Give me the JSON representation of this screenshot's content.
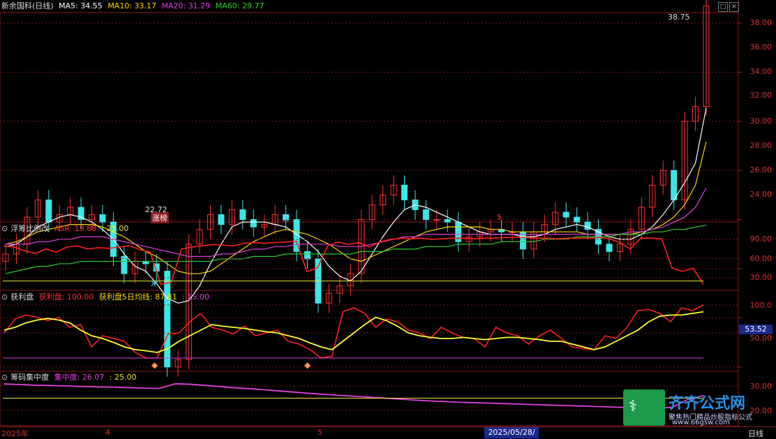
{
  "stock": {
    "title": "新余国科(日线)",
    "ma5": "MA5: 34.55",
    "ma10": "MA10: 33.17",
    "ma20": "MA20: 31.29",
    "ma60": "MA60: 29.77",
    "high_label": "38.75",
    "low_label": "22.72",
    "marks": [
      "涨榜",
      "财",
      "$"
    ]
  },
  "price_axis": [
    "38.00",
    "36.00",
    "34.00",
    "32.00",
    "30.00",
    "28.00",
    "26.00",
    "24.00"
  ],
  "panel_asr": {
    "title": "浮筹比例改",
    "label": "ASR: 19.88",
    "level": ": 25.00",
    "axis": [
      "90.00",
      "60.00",
      "30.00"
    ]
  },
  "panel_profit": {
    "title": "获利盘",
    "label": "获利盘: 100.00",
    "ma_label": "获利盘5日均线: 87.81",
    "level": ": 15.00",
    "axis": [
      "100.0",
      "50.00"
    ],
    "cursor_value": "53.52"
  },
  "panel_conc": {
    "title": "筹码集中度",
    "label": "集中度: 26.07",
    "level": ": 25.00",
    "axis": [
      "30.00",
      "20.00"
    ]
  },
  "date_axis": {
    "labels": [
      "2025年",
      "4",
      "5"
    ],
    "cursor_date": "2025/05/28/三",
    "period": "日线"
  },
  "watermark": {
    "brand": "齐齐公式网",
    "slogan": "聚焦热门精品炒股指标公式",
    "url": "www.66gsw.com"
  },
  "colors": {
    "up": "#ff3030",
    "down": "#3ce6e6",
    "ma5": "#ffffff",
    "ma10": "#ffd700",
    "ma20": "#e040e0",
    "ma60": "#30d030",
    "asr": "#ff2020",
    "level_line": "#e8e840",
    "conc": "#e040e0"
  },
  "icons": [
    "maximize-icon",
    "close-icon",
    "butterfly-icon",
    "diamond-icon",
    "dollar-icon"
  ],
  "chart_data": [
    {
      "type": "line",
      "title": "新余国科(日线)",
      "note": "candlestick price chart",
      "ylim": [
        23,
        39
      ],
      "x_count": 66,
      "series": [
        {
          "name": "close",
          "values": [
            28.6,
            29.0,
            30.1,
            30.8,
            29.9,
            30.2,
            30.5,
            30.0,
            30.2,
            29.9,
            28.5,
            27.8,
            28.3,
            28.2,
            27.9,
            24.0,
            24.3,
            29.0,
            29.6,
            30.2,
            29.8,
            30.4,
            30.0,
            29.7,
            29.8,
            30.2,
            30.0,
            28.7,
            28.4,
            26.6,
            27.0,
            27.3,
            27.8,
            30.0,
            30.6,
            31.0,
            31.4,
            30.8,
            30.4,
            30.0,
            30.0,
            29.9,
            29.1,
            29.3,
            29.5,
            29.6,
            29.5,
            29.5,
            28.8,
            29.5,
            29.8,
            30.3,
            30.1,
            29.9,
            29.6,
            29.0,
            28.7,
            29.0,
            29.6,
            30.5,
            31.4,
            32.0,
            30.8,
            34.0,
            34.6,
            38.7
          ]
        },
        {
          "name": "MA5",
          "values": [
            28.9,
            29.0,
            29.3,
            29.7,
            29.9,
            30.1,
            30.2,
            30.1,
            29.9,
            29.6,
            29.2,
            28.6,
            28.1,
            27.9,
            27.4,
            26.8,
            26.6,
            26.7,
            27.3,
            28.2,
            29.0,
            29.7,
            29.9,
            29.9,
            29.9,
            29.8,
            29.7,
            29.4,
            29.1,
            28.7,
            28.1,
            27.7,
            27.5,
            27.9,
            28.6,
            29.3,
            29.9,
            30.4,
            30.6,
            30.5,
            30.3,
            30.1,
            29.9,
            29.7,
            29.5,
            29.4,
            29.4,
            29.4,
            29.3,
            29.3,
            29.4,
            29.6,
            29.7,
            29.8,
            29.7,
            29.5,
            29.3,
            29.2,
            29.2,
            29.4,
            29.7,
            30.2,
            30.8,
            31.5,
            32.3,
            34.55
          ]
        },
        {
          "name": "MA10",
          "values": [
            29.0,
            29.1,
            29.3,
            29.5,
            29.6,
            29.7,
            29.8,
            29.8,
            29.8,
            29.7,
            29.5,
            29.3,
            29.0,
            28.7,
            28.5,
            28.2,
            27.9,
            27.8,
            27.8,
            27.9,
            28.2,
            28.5,
            28.8,
            29.1,
            29.3,
            29.5,
            29.6,
            29.5,
            29.4,
            29.2,
            29.0,
            28.7,
            28.4,
            28.3,
            28.5,
            28.7,
            28.9,
            29.1,
            29.3,
            29.5,
            29.6,
            29.7,
            29.7,
            29.7,
            29.7,
            29.6,
            29.6,
            29.5,
            29.5,
            29.5,
            29.5,
            29.5,
            29.5,
            29.5,
            29.4,
            29.4,
            29.4,
            29.4,
            29.4,
            29.5,
            29.6,
            29.8,
            30.1,
            30.6,
            31.4,
            33.17
          ]
        },
        {
          "name": "MA20",
          "values": [
            29.0,
            29.0,
            29.0,
            29.1,
            29.1,
            29.2,
            29.2,
            29.3,
            29.3,
            29.3,
            29.2,
            29.1,
            29.0,
            28.9,
            28.8,
            28.7,
            28.6,
            28.5,
            28.5,
            28.5,
            28.6,
            28.6,
            28.7,
            28.8,
            28.8,
            28.9,
            28.9,
            29.0,
            29.0,
            29.0,
            29.0,
            28.9,
            28.9,
            28.9,
            29.0,
            29.1,
            29.2,
            29.3,
            29.3,
            29.4,
            29.4,
            29.4,
            29.4,
            29.4,
            29.4,
            29.4,
            29.4,
            29.4,
            29.4,
            29.4,
            29.4,
            29.4,
            29.4,
            29.4,
            29.4,
            29.4,
            29.4,
            29.4,
            29.5,
            29.5,
            29.6,
            29.7,
            29.9,
            30.1,
            30.5,
            31.29
          ]
        },
        {
          "name": "MA60",
          "values": [
            27.8,
            27.9,
            28.0,
            28.1,
            28.1,
            28.2,
            28.2,
            28.3,
            28.3,
            28.3,
            28.3,
            28.3,
            28.3,
            28.3,
            28.3,
            28.3,
            28.3,
            28.3,
            28.3,
            28.3,
            28.4,
            28.4,
            28.4,
            28.5,
            28.5,
            28.5,
            28.6,
            28.6,
            28.6,
            28.6,
            28.6,
            28.6,
            28.6,
            28.7,
            28.7,
            28.7,
            28.8,
            28.8,
            28.8,
            28.9,
            28.9,
            28.9,
            29.0,
            29.0,
            29.0,
            29.0,
            29.1,
            29.1,
            29.1,
            29.1,
            29.2,
            29.2,
            29.2,
            29.3,
            29.3,
            29.3,
            29.3,
            29.4,
            29.4,
            29.4,
            29.5,
            29.5,
            29.6,
            29.6,
            29.7,
            29.77
          ]
        }
      ]
    },
    {
      "type": "line",
      "title": "浮筹比例改",
      "ylim": [
        15,
        100
      ],
      "series": [
        {
          "name": "ASR",
          "values": [
            80,
            78,
            72,
            68,
            75,
            70,
            78,
            80,
            75,
            77,
            76,
            78,
            80,
            74,
            70,
            20,
            23,
            75,
            78,
            80,
            82,
            81,
            80,
            84,
            85,
            84,
            85,
            86,
            87,
            40,
            45,
            80,
            86,
            82,
            85,
            78,
            86,
            90,
            92,
            91,
            92,
            90,
            91,
            92,
            92,
            91,
            92,
            92,
            93,
            93,
            93,
            92,
            92,
            91,
            92,
            92,
            92,
            93,
            91,
            85,
            75,
            92,
            92,
            91,
            45,
            40,
            45,
            19.88
          ]
        }
      ]
    },
    {
      "type": "line",
      "title": "获利盘",
      "ylim": [
        0,
        110
      ],
      "series": [
        {
          "name": "获利盘",
          "values": [
            50,
            75,
            82,
            78,
            72,
            78,
            60,
            65,
            25,
            45,
            40,
            35,
            15,
            5,
            5,
            48,
            50,
            70,
            85,
            60,
            55,
            48,
            62,
            45,
            50,
            55,
            35,
            30,
            20,
            5,
            8,
            88,
            95,
            85,
            60,
            75,
            70,
            55,
            50,
            40,
            60,
            50,
            42,
            40,
            25,
            60,
            50,
            45,
            30,
            45,
            55,
            40,
            25,
            22,
            20,
            45,
            40,
            60,
            90,
            92,
            85,
            70,
            95,
            90,
            100
          ]
        },
        {
          "name": "获利盘5日均线",
          "values": [
            55,
            60,
            68,
            73,
            76,
            73,
            68,
            55,
            45,
            40,
            33,
            25,
            20,
            18,
            15,
            22,
            35,
            45,
            55,
            65,
            62,
            60,
            58,
            55,
            52,
            50,
            45,
            40,
            32,
            25,
            20,
            35,
            50,
            65,
            78,
            72,
            62,
            50,
            45,
            42,
            40,
            40,
            42,
            40,
            38,
            40,
            42,
            42,
            40,
            38,
            35,
            35,
            30,
            25,
            20,
            25,
            35,
            45,
            55,
            70,
            80,
            82,
            82,
            85,
            87.81
          ]
        },
        {
          "name": "level",
          "values": [
            15
          ]
        }
      ]
    },
    {
      "type": "line",
      "title": "筹码集中度",
      "ylim": [
        19,
        31
      ],
      "series": [
        {
          "name": "集中度",
          "values": [
            30.8,
            30.6,
            30.3,
            30.2,
            30.0,
            29.8,
            29.6,
            29.5,
            29.3,
            29.1,
            29.0,
            30.9,
            30.7,
            30.2,
            29.7,
            29.2,
            28.8,
            28.3,
            27.8,
            27.3,
            26.8,
            26.4,
            26.0,
            25.6,
            25.2,
            24.8,
            24.4,
            24.0,
            23.7,
            23.4,
            23.2,
            23.0,
            22.8,
            22.6,
            22.4,
            22.2,
            22.0,
            21.8,
            21.6,
            21.4,
            21.2,
            21.0,
            20.8,
            21.3,
            24.5,
            26.07
          ]
        }
      ]
    }
  ]
}
